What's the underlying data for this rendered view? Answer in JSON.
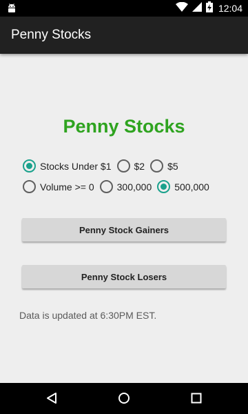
{
  "status_bar": {
    "time": "12:04",
    "icons": [
      "android-icon",
      "wifi-icon",
      "signal-icon",
      "battery-charging-icon"
    ]
  },
  "app_bar": {
    "title": "Penny Stocks"
  },
  "heading": "Penny Stocks",
  "price_options": [
    {
      "label": "Stocks Under $1",
      "checked": true
    },
    {
      "label": "$2",
      "checked": false
    },
    {
      "label": "$5",
      "checked": false
    }
  ],
  "volume_options": [
    {
      "label": "Volume >= 0",
      "checked": false
    },
    {
      "label": "300,000",
      "checked": false
    },
    {
      "label": "500,000",
      "checked": true
    }
  ],
  "buttons": {
    "gainers": "Penny Stock Gainers",
    "losers": "Penny Stock Losers"
  },
  "note": "Data is updated at 6:30PM EST.",
  "nav_bar": {
    "icons": [
      "back-icon",
      "home-icon",
      "recents-icon"
    ]
  },
  "colors": {
    "accent": "#1aa18c",
    "heading": "#2ea31f",
    "app_bar": "#212121",
    "background": "#eeeeee",
    "button": "#d7d7d7"
  }
}
